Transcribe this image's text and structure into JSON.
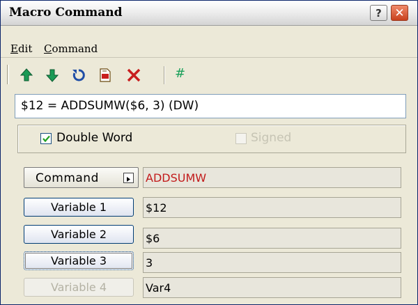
{
  "window": {
    "title": "Macro Command",
    "help_glyph": "?",
    "close_glyph": "✕"
  },
  "menu": {
    "edit": {
      "mnemonic": "E",
      "rest": "dit"
    },
    "command": {
      "mnemonic": "C",
      "rest": "ommand"
    }
  },
  "toolbar": {
    "icons": [
      "up-arrow-icon",
      "down-arrow-icon",
      "undo-icon",
      "document-icon",
      "delete-icon",
      "hash-icon"
    ],
    "hash_glyph": "#",
    "colors": {
      "arrows": "#1a9a55",
      "undo": "#1f4ea6",
      "delete": "#c81e1e"
    }
  },
  "expression": "$12 = ADDSUMW($6, 3) (DW)",
  "options": {
    "double_word": {
      "label": "Double Word",
      "checked": true
    },
    "signed": {
      "label": "Signed",
      "checked": false,
      "enabled": false
    }
  },
  "command": {
    "button_label": "Command",
    "value": "ADDSUMW"
  },
  "variables": [
    {
      "label": "Variable 1",
      "value": "$12",
      "enabled": true
    },
    {
      "label": "Variable 2",
      "value": "$6",
      "enabled": true
    },
    {
      "label": "Variable 3",
      "value": "3",
      "enabled": true
    },
    {
      "label": "Variable 4",
      "value": "Var4",
      "enabled": false
    }
  ]
}
